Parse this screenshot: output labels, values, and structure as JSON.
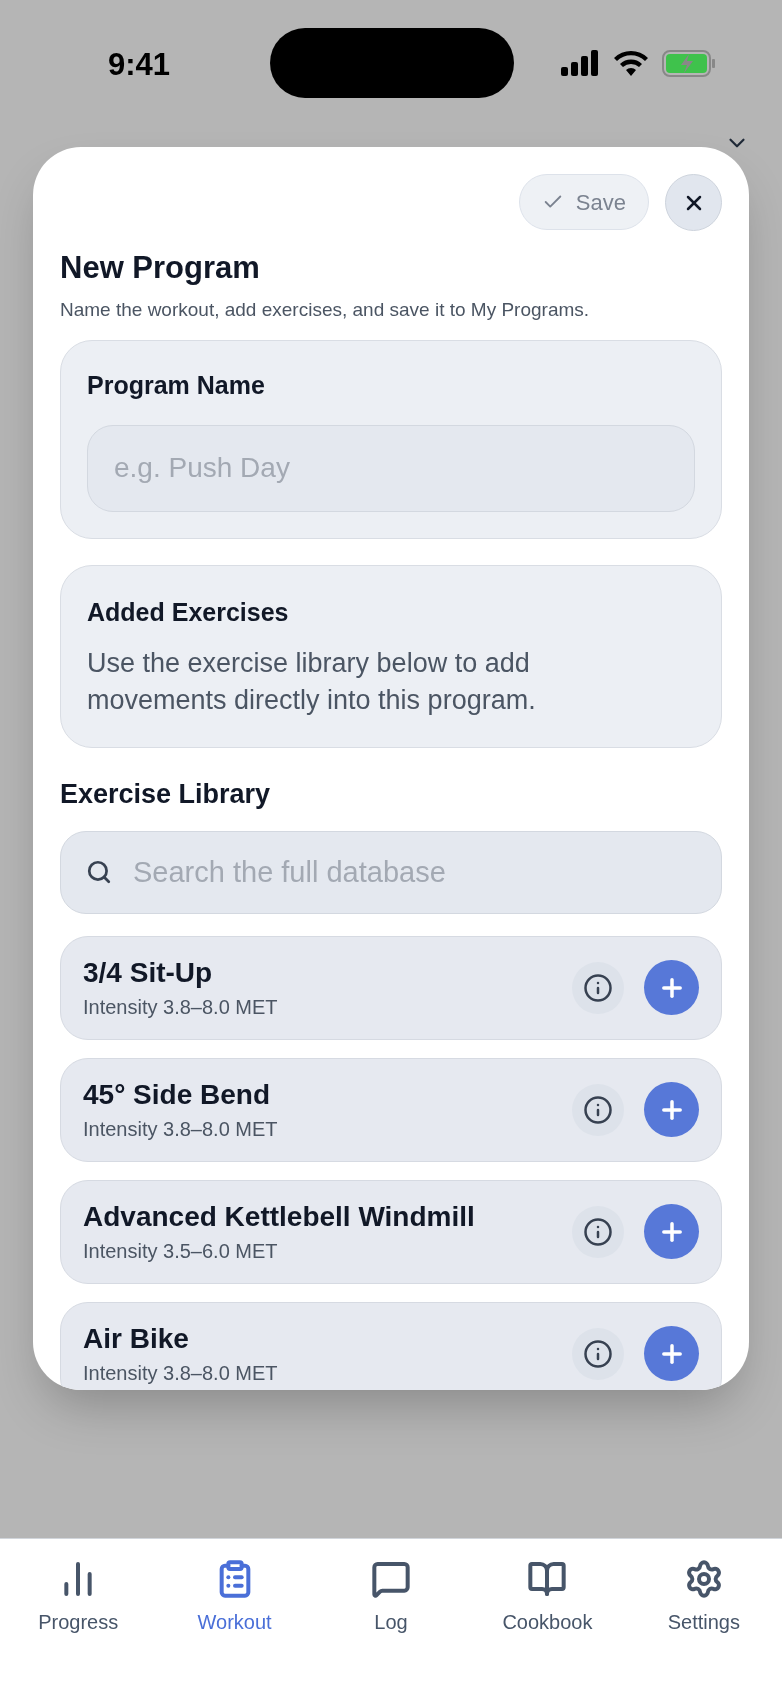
{
  "status_bar": {
    "time": "9:41"
  },
  "modal": {
    "save_button": "Save",
    "title": "New Program",
    "subtitle": "Name the workout, add exercises, and save it to My Programs.",
    "program_name": {
      "label": "Program Name",
      "placeholder": "e.g. Push Day"
    },
    "added_exercises": {
      "title": "Added Exercises",
      "hint": "Use the exercise library below to add movements directly into this program."
    },
    "library": {
      "title": "Exercise Library",
      "search": {
        "placeholder": "Search the full database"
      },
      "exercises": [
        {
          "name": "3/4 Sit-Up",
          "intensity": "Intensity 3.8–8.0 MET"
        },
        {
          "name": "45° Side Bend",
          "intensity": "Intensity 3.8–8.0 MET"
        },
        {
          "name": "Advanced Kettlebell Windmill",
          "intensity": "Intensity 3.5–6.0 MET"
        },
        {
          "name": "Air Bike",
          "intensity": "Intensity 3.8–8.0 MET"
        }
      ]
    }
  },
  "tab_bar": [
    {
      "label": "Progress",
      "kind": "progress",
      "selected": false
    },
    {
      "label": "Workout",
      "kind": "workout",
      "selected": true
    },
    {
      "label": "Log",
      "kind": "log",
      "selected": false
    },
    {
      "label": "Cookbook",
      "kind": "cookbook",
      "selected": false
    },
    {
      "label": "Settings",
      "kind": "settings",
      "selected": false
    }
  ]
}
